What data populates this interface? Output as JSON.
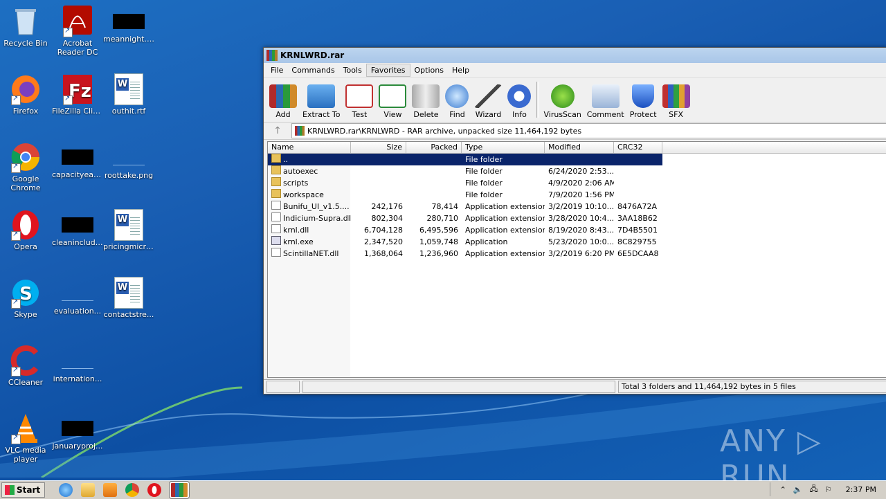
{
  "desktop": {
    "icons": [
      {
        "label": "Recycle Bin"
      },
      {
        "label": "Acrobat Reader DC"
      },
      {
        "label": "meannight.jpg"
      },
      {
        "label": "Firefox"
      },
      {
        "label": "FileZilla Client"
      },
      {
        "label": "outhit.rtf"
      },
      {
        "label": "Google Chrome"
      },
      {
        "label": "capacityeac..."
      },
      {
        "label": "roottake.png"
      },
      {
        "label": "Opera"
      },
      {
        "label": "cleaninclude..."
      },
      {
        "label": "pricingmicro..."
      },
      {
        "label": "Skype"
      },
      {
        "label": "evaluation..."
      },
      {
        "label": "contactstre..."
      },
      {
        "label": "CCleaner"
      },
      {
        "label": "internation..."
      },
      {
        "label": "VLC media player"
      },
      {
        "label": "januaryproj..."
      }
    ]
  },
  "window": {
    "title": "KRNLWRD.rar",
    "menu": [
      "File",
      "Commands",
      "Tools",
      "Favorites",
      "Options",
      "Help"
    ],
    "active_menu": "Favorites",
    "toolbar": [
      "Add",
      "Extract To",
      "Test",
      "View",
      "Delete",
      "Find",
      "Wizard",
      "Info",
      "VirusScan",
      "Comment",
      "Protect",
      "SFX"
    ],
    "address": "KRNLWRD.rar\\KRNLWRD - RAR archive, unpacked size 11,464,192 bytes",
    "columns": [
      "Name",
      "Size",
      "Packed",
      "Type",
      "Modified",
      "CRC32"
    ],
    "rows": [
      {
        "name": "..",
        "size": "",
        "packed": "",
        "type": "File folder",
        "modified": "",
        "crc": "",
        "icon": "folder"
      },
      {
        "name": "autoexec",
        "size": "",
        "packed": "",
        "type": "File folder",
        "modified": "6/24/2020 2:53...",
        "crc": "",
        "icon": "folder"
      },
      {
        "name": "scripts",
        "size": "",
        "packed": "",
        "type": "File folder",
        "modified": "4/9/2020 2:06 AM",
        "crc": "",
        "icon": "folder"
      },
      {
        "name": "workspace",
        "size": "",
        "packed": "",
        "type": "File folder",
        "modified": "7/9/2020 1:56 PM",
        "crc": "",
        "icon": "folder"
      },
      {
        "name": "Bunifu_UI_v1.5....",
        "size": "242,176",
        "packed": "78,414",
        "type": "Application extension",
        "modified": "3/2/2019 10:10...",
        "crc": "8476A72A",
        "icon": "dll"
      },
      {
        "name": "Indicium-Supra.dll",
        "size": "802,304",
        "packed": "280,710",
        "type": "Application extension",
        "modified": "3/28/2020 10:4...",
        "crc": "3AA18B62",
        "icon": "dll"
      },
      {
        "name": "krnl.dll",
        "size": "6,704,128",
        "packed": "6,495,596",
        "type": "Application extension",
        "modified": "8/19/2020 8:43...",
        "crc": "7D4B5501",
        "icon": "dll"
      },
      {
        "name": "krnl.exe",
        "size": "2,347,520",
        "packed": "1,059,748",
        "type": "Application",
        "modified": "5/23/2020 10:0...",
        "crc": "8C829755",
        "icon": "exe"
      },
      {
        "name": "ScintillaNET.dll",
        "size": "1,368,064",
        "packed": "1,236,960",
        "type": "Application extension",
        "modified": "3/2/2019 6:20 PM",
        "crc": "6E5DCAA8",
        "icon": "dll"
      }
    ],
    "status": "Total 3 folders and 11,464,192 bytes in 5 files"
  },
  "taskbar": {
    "start_label": "Start",
    "clock": "2:37 PM"
  },
  "watermark": "ANY ▷ RUN"
}
